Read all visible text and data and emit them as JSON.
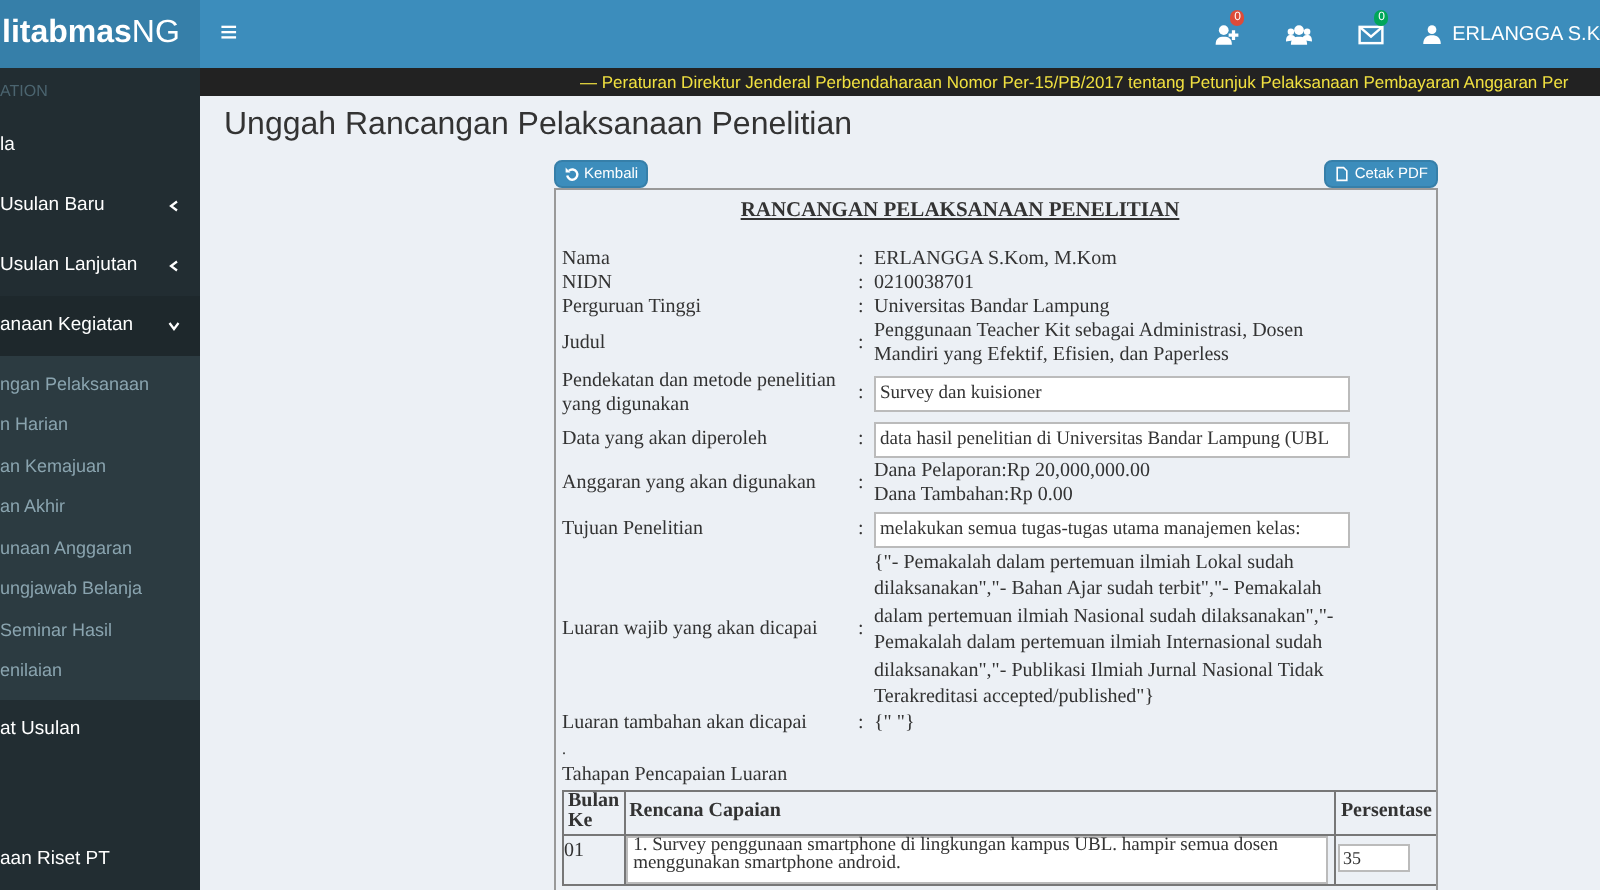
{
  "header": {
    "logo": "litabmasNG",
    "menu_toggle": "≡",
    "badges": [
      {
        "kind": "user-plus",
        "count": "0",
        "color": "#dd4b39"
      },
      {
        "kind": "users"
      },
      {
        "kind": "envelope",
        "count": "0",
        "color": "#00a65a"
      }
    ],
    "user": "ERLANGGA S.K"
  },
  "ticker": "— Peraturan Direktur Jenderal Perbendaharaan Nomor Per-15/PB/2017 tentang Petunjuk Pelaksanaan Pembayaran Anggaran Per",
  "sidebar": {
    "header": "ATION",
    "items": [
      {
        "label": "la"
      },
      {
        "label": "Usulan Baru",
        "expanded": false
      },
      {
        "label": "Usulan Lanjutan",
        "expanded": false
      },
      {
        "label": "anaan Kegiatan",
        "expanded": true,
        "children": [
          {
            "label": "ngan Pelaksanaan"
          },
          {
            "label": "n Harian"
          },
          {
            "label": "an Kemajuan"
          },
          {
            "label": "an Akhir"
          },
          {
            "label": "unaan Anggaran"
          },
          {
            "label": "ungjawab Belanja"
          },
          {
            "label": "Seminar Hasil"
          },
          {
            "label": "enilaian"
          }
        ]
      },
      {
        "label": "at Usulan"
      },
      {
        "label": "aan Riset PT"
      }
    ]
  },
  "page_title": "Unggah Rancangan Pelaksanaan Penelitian",
  "buttons": [
    {
      "kind": "back",
      "label": "Kembali"
    },
    {
      "kind": "pdf",
      "label": "Cetak PDF"
    }
  ],
  "document": {
    "title": "RANCANGAN PELAKSANAAN PENELITIAN",
    "fields": [
      {
        "kind": "text",
        "label": "Nama",
        "separator": ":",
        "value": "ERLANGGA S.Kom, M.Kom"
      },
      {
        "kind": "text",
        "label": "NIDN",
        "separator": ":",
        "value": "0210038701"
      },
      {
        "kind": "text",
        "label": "Perguruan Tinggi",
        "separator": ":",
        "value": "Universitas Bandar Lampung"
      },
      {
        "kind": "text",
        "label": "Judul",
        "separator": ":",
        "value": "Penggunaan Teacher Kit sebagai Administrasi, Dosen Mandiri yang Efektif, Efisien, dan Paperless"
      },
      {
        "kind": "input",
        "label": "Pendekatan dan metode penelitian yang digunakan",
        "separator": ":",
        "value": "Survey dan kuisioner"
      },
      {
        "kind": "input",
        "label": "Data yang akan diperoleh",
        "separator": ":",
        "value": "data hasil penelitian di Universitas Bandar Lampung (UBL"
      },
      {
        "kind": "lines",
        "label": "Anggaran yang akan digunakan",
        "separator": ":",
        "lines": [
          "Dana Pelaporan:Rp 20,000,000.00",
          "Dana Tambahan:Rp 0.00"
        ]
      },
      {
        "kind": "input",
        "label": "Tujuan Penelitian",
        "separator": ":",
        "value": "melakukan semua tugas-tugas utama manajemen kelas:"
      },
      {
        "kind": "text",
        "label": "Luaran wajib yang akan dicapai",
        "separator": ":",
        "value": "{\"- Pemakalah dalam pertemuan ilmiah Lokal sudah dilaksanakan\",\"- Bahan Ajar sudah terbit\",\"- Pemakalah dalam pertemuan ilmiah Nasional sudah dilaksanakan\",\"- Pemakalah dalam pertemuan ilmiah Internasional sudah dilaksanakan\",\"- Publikasi Ilmiah Jurnal Nasional Tidak Terakreditasi accepted/published\"}"
      },
      {
        "kind": "text",
        "label": "Luaran tambahan akan dicapai",
        "separator": ":",
        "value": "{\" \"}"
      }
    ],
    "dot": ".",
    "stages_title": "Tahapan Pencapaian Luaran",
    "table": {
      "columns": [
        "Bulan Ke",
        "Rencana Capaian",
        "Persentase"
      ],
      "rows": [
        {
          "month": "01",
          "plan": "1. Survey penggunaan smartphone di lingkungan kampus UBL. hampir semua dosen menggunakan smartphone android.",
          "percent": "35"
        }
      ]
    }
  }
}
